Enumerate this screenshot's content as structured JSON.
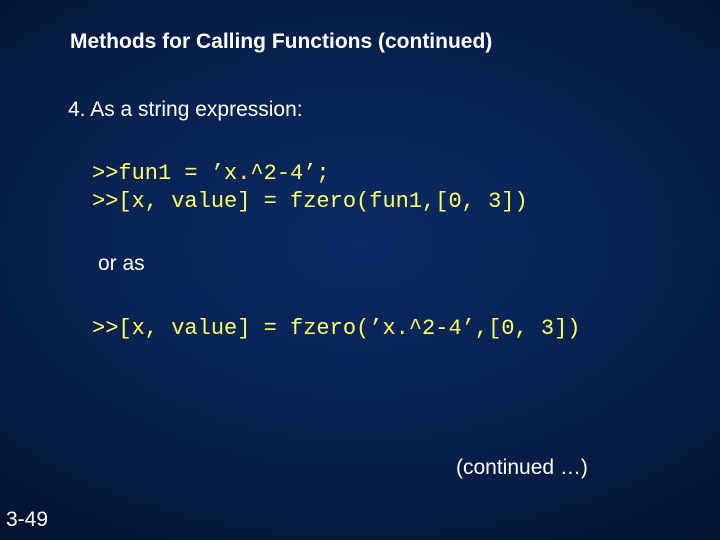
{
  "title": "Methods for Calling Functions (continued)",
  "item4": "4.   As a string expression:",
  "code1_line1": ">>fun1 = ’x.^2-4’;",
  "code1_line2": ">>[x, value] = fzero(fun1,[0, 3])",
  "oras": "or as",
  "code2": ">>[x, value] = fzero(’x.^2-4’,[0, 3])",
  "continued": "(continued …)",
  "pagenum": "3-49"
}
